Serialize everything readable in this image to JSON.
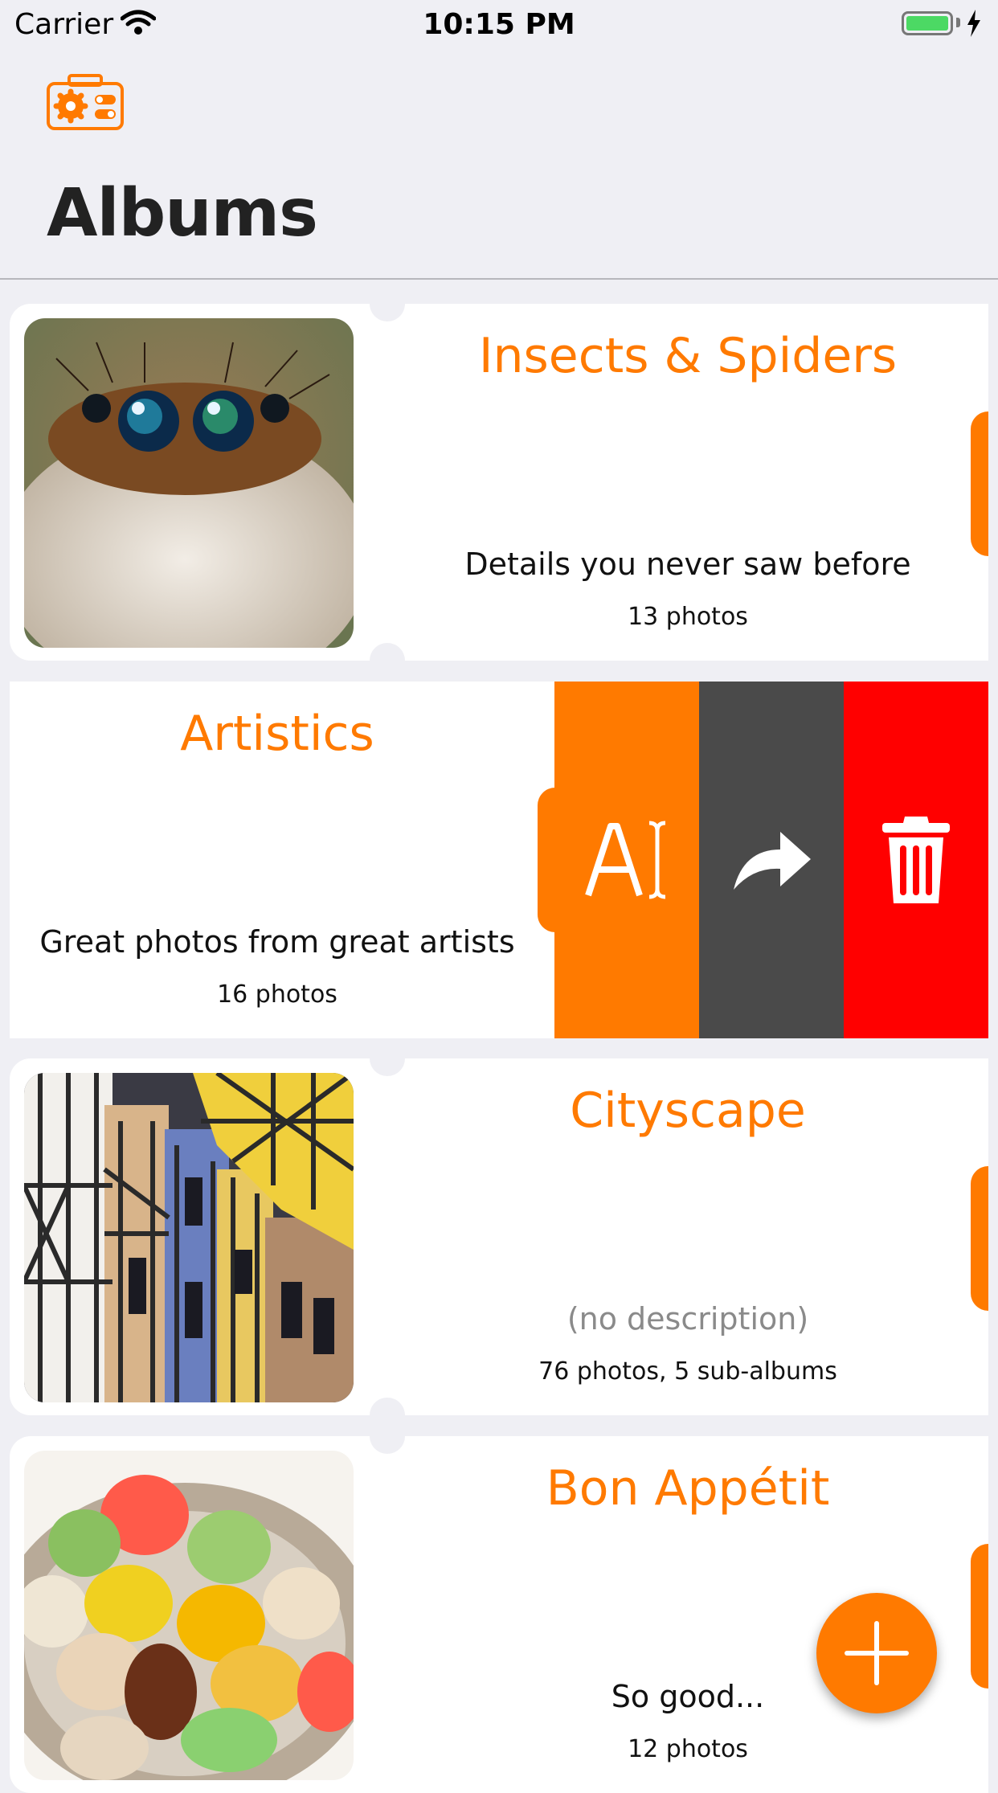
{
  "status_bar": {
    "carrier": "Carrier",
    "time": "10:15 PM"
  },
  "nav": {
    "title": "Albums",
    "settings_icon": "settings-camera-icon"
  },
  "albums": [
    {
      "title": "Insects & Spiders",
      "description": "Details you never saw before",
      "count": "13 photos",
      "thumbnail": "jumping-spider-photo"
    },
    {
      "title": "Artistics",
      "description": "Great photos from great artists",
      "count": "16 photos",
      "actions": [
        "rename-icon",
        "move-icon",
        "trash-icon"
      ]
    },
    {
      "title": "Cityscape",
      "description": "(no description)",
      "count": "76 photos, 5 sub-albums",
      "thumbnail": "half-timbered-houses-photo"
    },
    {
      "title": "Bon Appétit",
      "description": "So good...",
      "count": "12 photos",
      "thumbnail": "macarons-photo"
    }
  ],
  "fab": {
    "icon": "plus-icon"
  },
  "colors": {
    "accent": "#ff7a00",
    "move_action": "#4a4a4a",
    "delete_action": "#ff0000",
    "background": "#efeff4"
  }
}
